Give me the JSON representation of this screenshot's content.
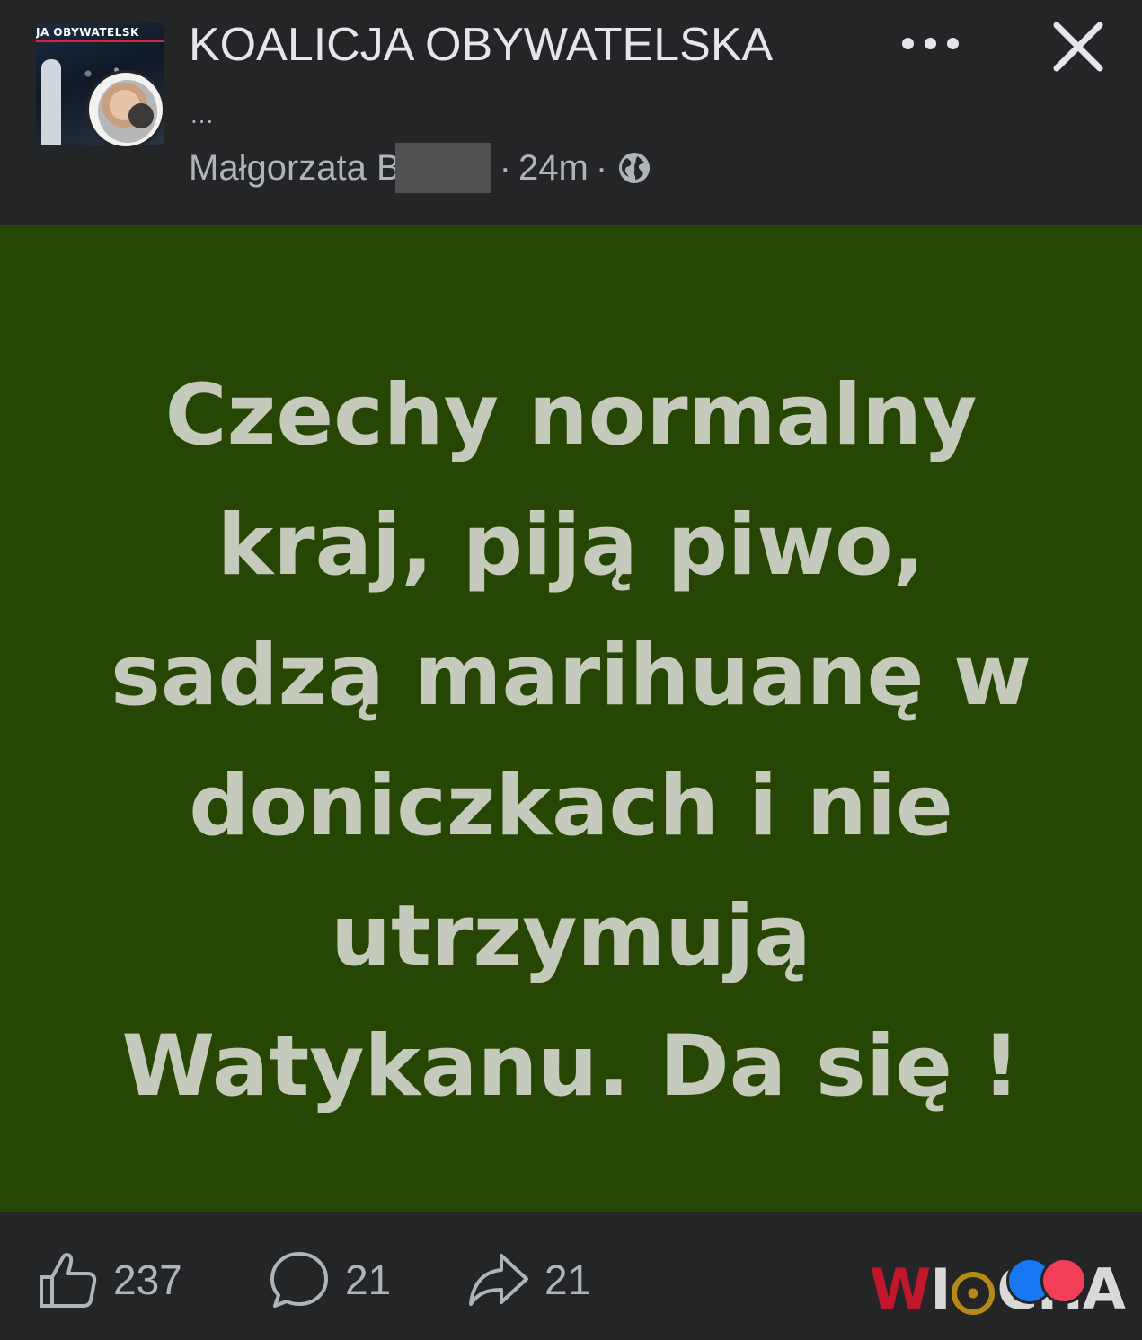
{
  "post": {
    "group_name": "KOALICJA OBYWATELSKA",
    "group_thumb_text": "JA OBYWATELSK",
    "header_ellipsis": "...",
    "author": "Małgorzata B",
    "separator": "·",
    "time": "24m",
    "image_text": {
      "lines": [
        "Czechy normalny",
        "kraj, piją piwo,",
        "sadzą marihuanę w",
        "doniczkach i nie",
        "utrzymują",
        "Watykanu. Da się !"
      ],
      "background_color": "#264703",
      "text_color": "#c5cbbc"
    }
  },
  "icons": {
    "more": "more-horizontal-icon",
    "close": "close-icon",
    "privacy": "globe-icon",
    "like": "thumbs-up-icon",
    "comment": "comment-icon",
    "share": "share-icon"
  },
  "actions": {
    "likes": "237",
    "comments": "21",
    "shares": "21"
  },
  "watermark": {
    "w": "W",
    "i": "I",
    "cha": "CHA"
  }
}
